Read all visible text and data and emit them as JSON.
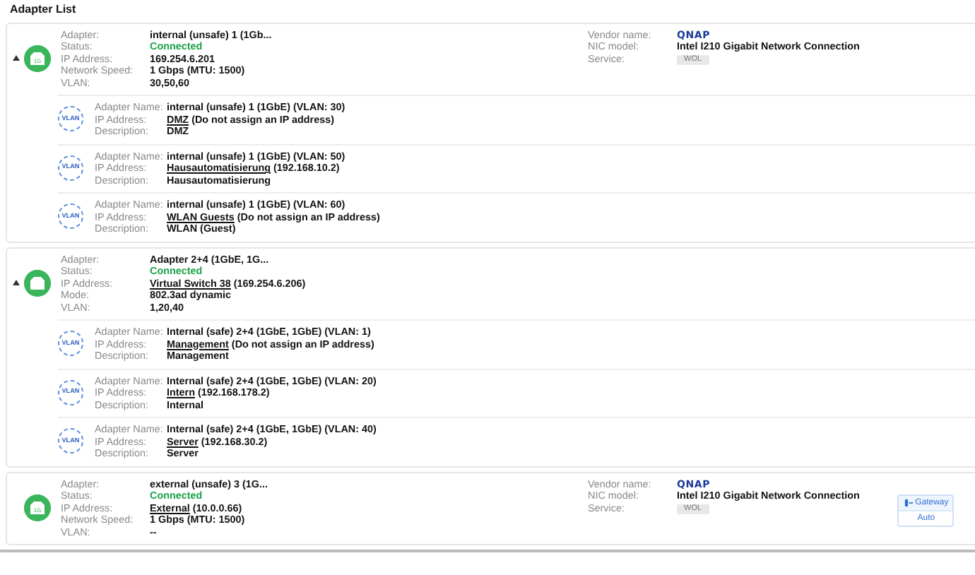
{
  "title": "Adapter List",
  "adapters": [
    {
      "expanded": true,
      "icon_label": "1G",
      "fields": [
        {
          "label": "Adapter:",
          "value": "internal (unsafe) 1 (1Gb...",
          "kind": "text"
        },
        {
          "label": "Status:",
          "value": "Connected",
          "kind": "status"
        },
        {
          "label": "IP Address:",
          "value": "169.254.6.201",
          "kind": "text"
        },
        {
          "label": "Network Speed:",
          "value": "1 Gbps (MTU: 1500)",
          "kind": "text"
        },
        {
          "label": "VLAN:",
          "value": "30,50,60",
          "kind": "text"
        }
      ],
      "vendor": {
        "vendor_label": "Vendor name:",
        "logo": "QNAP",
        "model_label": "NIC model:",
        "model": "Intel I210 Gigabit Network Connection",
        "service_label": "Service:",
        "service": "WOL",
        "service_enabled": false
      },
      "vlans": [
        {
          "icon_label": "VLAN",
          "fields": [
            {
              "label": "Adapter Name:",
              "value": "internal (unsafe) 1 (1GbE) (VLAN: 30)",
              "kind": "text"
            },
            {
              "label": "IP Address:",
              "link": "DMZ",
              "value": " (Do not assign an IP address)",
              "kind": "link"
            },
            {
              "label": "Description:",
              "value": "DMZ",
              "kind": "text"
            }
          ]
        },
        {
          "icon_label": "VLAN",
          "fields": [
            {
              "label": "Adapter Name:",
              "value": "internal (unsafe) 1 (1GbE) (VLAN: 50)",
              "kind": "text"
            },
            {
              "label": "IP Address:",
              "link": "Hausautomatisierung",
              "value": " (192.168.10.2)",
              "kind": "link"
            },
            {
              "label": "Description:",
              "value": "Hausautomatisierung",
              "kind": "text"
            }
          ]
        },
        {
          "icon_label": "VLAN",
          "fields": [
            {
              "label": "Adapter Name:",
              "value": "internal (unsafe) 1 (1GbE) (VLAN: 60)",
              "kind": "text"
            },
            {
              "label": "IP Address:",
              "link": "WLAN Guests",
              "value": " (Do not assign an IP address)",
              "kind": "link"
            },
            {
              "label": "Description:",
              "value": "WLAN (Guest)",
              "kind": "text"
            }
          ]
        }
      ]
    },
    {
      "expanded": true,
      "fields": [
        {
          "label": "Adapter:",
          "value": "Adapter 2+4 (1GbE, 1G...",
          "kind": "text"
        },
        {
          "label": "Status:",
          "value": "Connected",
          "kind": "status"
        },
        {
          "label": "IP Address:",
          "link": "Virtual Switch 38",
          "value": " (169.254.6.206)",
          "kind": "link"
        },
        {
          "label": "Mode:",
          "value": "802.3ad dynamic",
          "kind": "text"
        },
        {
          "label": "VLAN:",
          "value": "1,20,40",
          "kind": "text"
        }
      ],
      "vlans": [
        {
          "icon_label": "VLAN",
          "fields": [
            {
              "label": "Adapter Name:",
              "value": "Internal (safe) 2+4 (1GbE, 1GbE) (VLAN: 1)",
              "kind": "text"
            },
            {
              "label": "IP Address:",
              "link": "Management",
              "value": " (Do not assign an IP address)",
              "kind": "link"
            },
            {
              "label": "Description:",
              "value": "Management",
              "kind": "text"
            }
          ]
        },
        {
          "icon_label": "VLAN",
          "fields": [
            {
              "label": "Adapter Name:",
              "value": "Internal (safe) 2+4 (1GbE, 1GbE) (VLAN: 20)",
              "kind": "text"
            },
            {
              "label": "IP Address:",
              "link": "Intern",
              "value": " (192.168.178.2)",
              "kind": "link"
            },
            {
              "label": "Description:",
              "value": "Internal",
              "kind": "text"
            }
          ]
        },
        {
          "icon_label": "VLAN",
          "fields": [
            {
              "label": "Adapter Name:",
              "value": "Internal (safe) 2+4 (1GbE, 1GbE) (VLAN: 40)",
              "kind": "text"
            },
            {
              "label": "IP Address:",
              "link": "Server",
              "value": " (192.168.30.2)",
              "kind": "link"
            },
            {
              "label": "Description:",
              "value": "Server",
              "kind": "text"
            }
          ]
        }
      ]
    },
    {
      "icon_label": "1G",
      "fields": [
        {
          "label": "Adapter:",
          "value": "external (unsafe) 3 (1G...",
          "kind": "text"
        },
        {
          "label": "Status:",
          "value": "Connected",
          "kind": "status"
        },
        {
          "label": "IP Address:",
          "link": "External",
          "value": " (10.0.0.66)",
          "kind": "link"
        },
        {
          "label": "Network Speed:",
          "value": "1 Gbps (MTU: 1500)",
          "kind": "text"
        },
        {
          "label": "VLAN:",
          "value": "--",
          "kind": "text"
        }
      ],
      "vendor": {
        "vendor_label": "Vendor name:",
        "logo": "QNAP",
        "model_label": "NIC model:",
        "model": "Intel I210 Gigabit Network Connection",
        "service_label": "Service:",
        "service": "WOL",
        "service_enabled": false
      },
      "gateway": {
        "label": "Gateway",
        "mode": "Auto"
      }
    }
  ]
}
